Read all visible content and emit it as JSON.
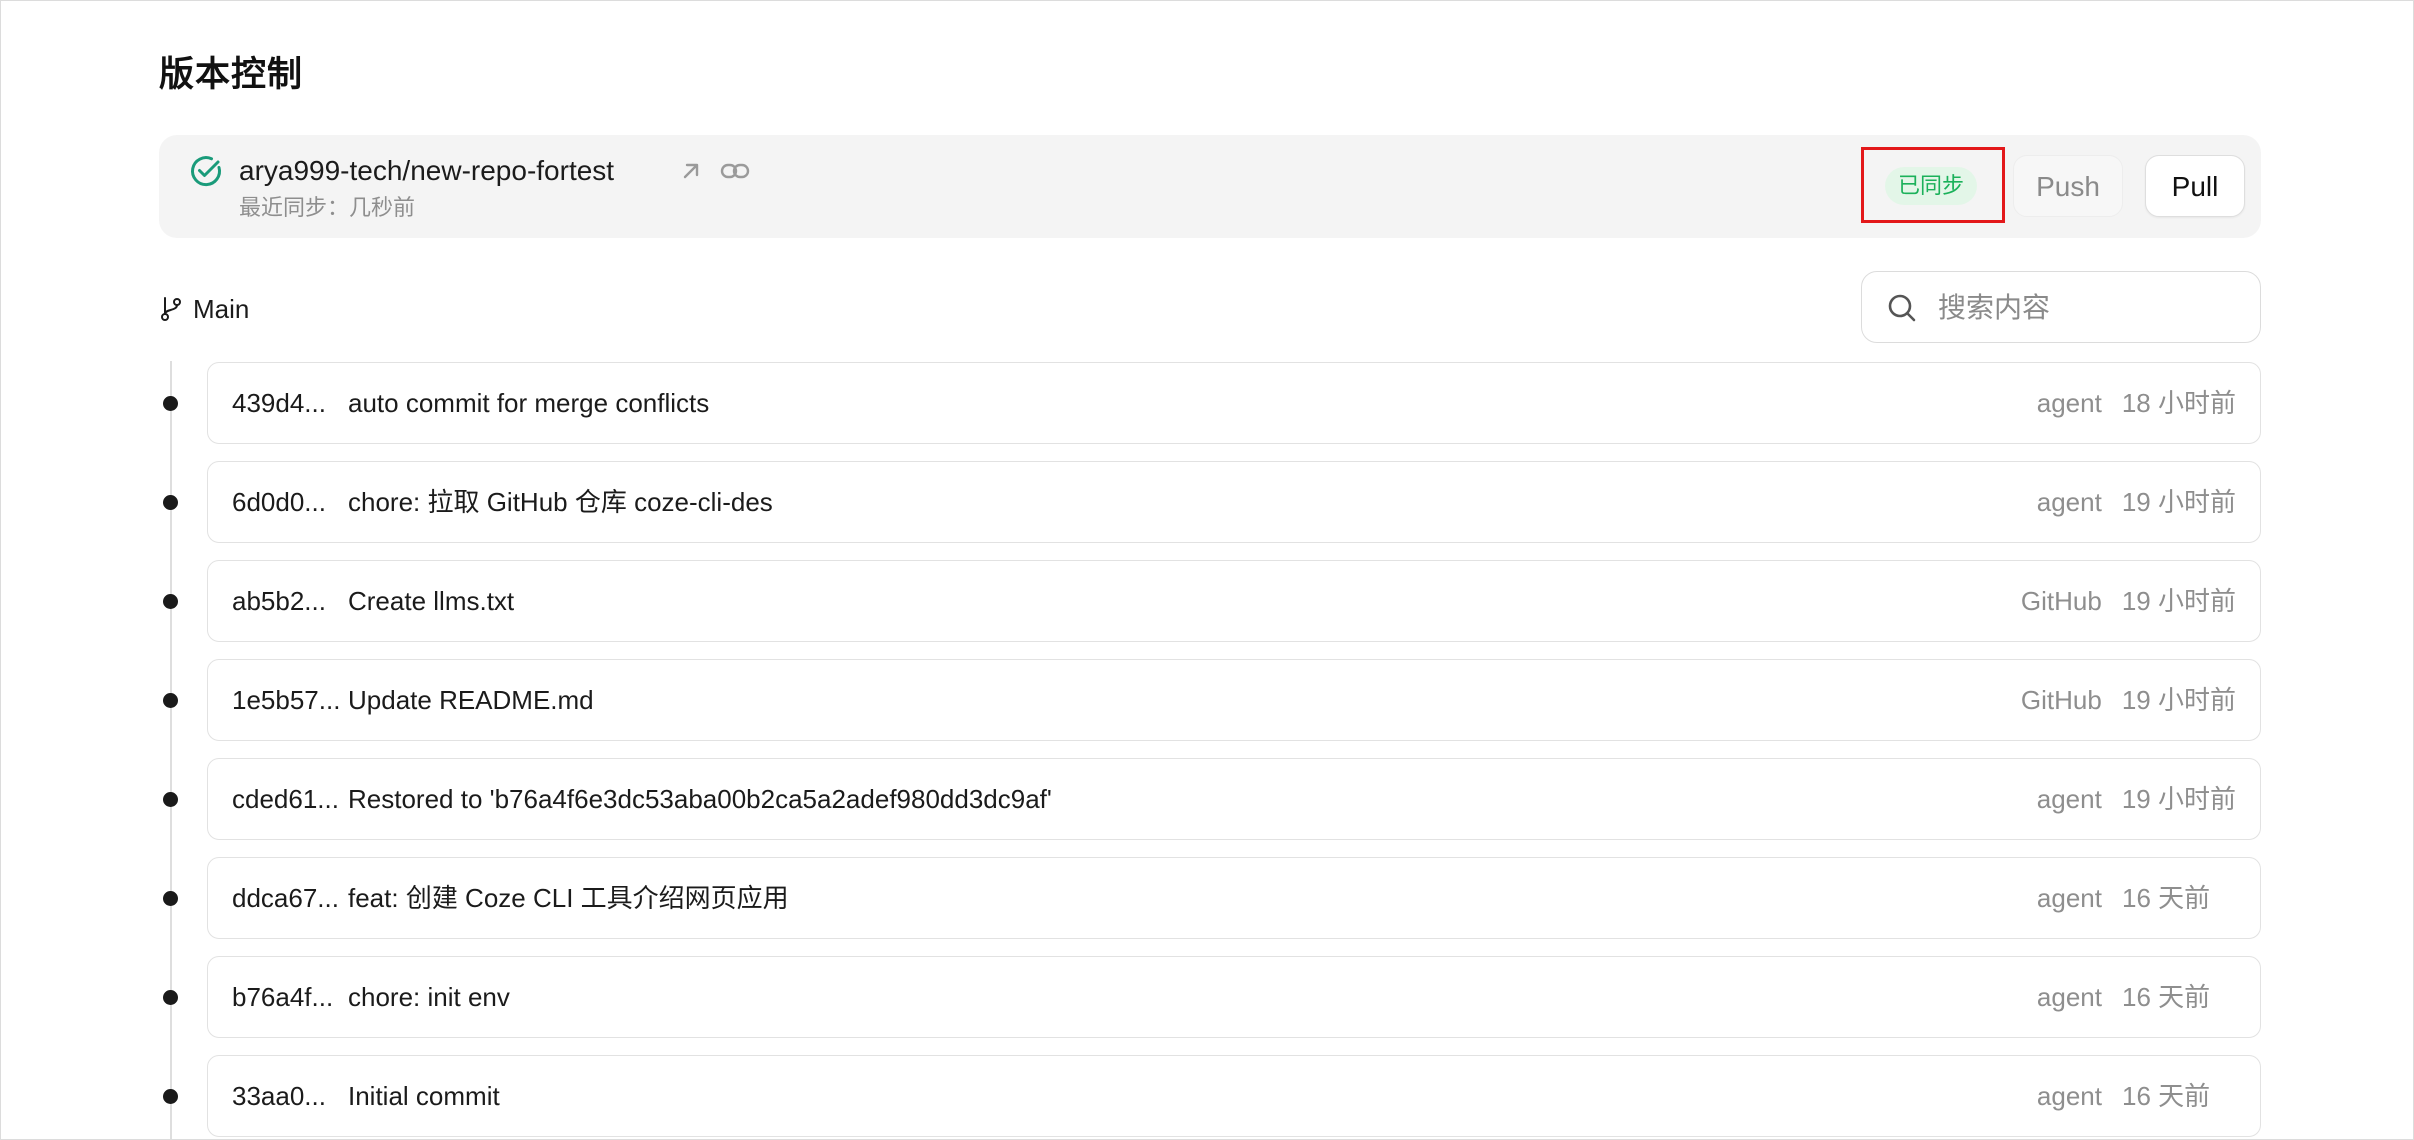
{
  "page": {
    "title": "版本控制"
  },
  "repo": {
    "name": "arya999-tech/new-repo-fortest",
    "last_sync": "最近同步：几秒前",
    "status": "已同步",
    "push_label": "Push",
    "pull_label": "Pull"
  },
  "branch": {
    "label": "Main"
  },
  "search": {
    "placeholder": "搜索内容",
    "value": ""
  },
  "commits": [
    {
      "hash": "439d4...",
      "message": "auto commit for merge conflicts",
      "author": "agent",
      "time": "18 小时前"
    },
    {
      "hash": "6d0d0...",
      "message": "chore: 拉取 GitHub 仓库 coze-cli-des",
      "author": "agent",
      "time": "19 小时前"
    },
    {
      "hash": "ab5b2...",
      "message": "Create llms.txt",
      "author": "GitHub",
      "time": "19 小时前"
    },
    {
      "hash": "1e5b57...",
      "message": "Update README.md",
      "author": "GitHub",
      "time": "19 小时前"
    },
    {
      "hash": "cded61...",
      "message": "Restored to 'b76a4f6e3dc53aba00b2ca5a2adef980dd3dc9af'",
      "author": "agent",
      "time": "19 小时前"
    },
    {
      "hash": "ddca67...",
      "message": "feat: 创建 Coze CLI 工具介绍网页应用",
      "author": "agent",
      "time": "16 天前"
    },
    {
      "hash": "b76a4f...",
      "message": "chore: init env",
      "author": "agent",
      "time": "16 天前"
    },
    {
      "hash": "33aa0...",
      "message": "Initial commit",
      "author": "agent",
      "time": "16 天前"
    }
  ],
  "colors": {
    "status_green": "#1bb15a",
    "status_bg": "#e3f6e8",
    "highlight_red": "#e3181a",
    "check_teal": "#1a9b7a"
  },
  "icons": {
    "repo_status": "check-circle-icon",
    "open_external": "arrow-up-right-icon",
    "copy_link": "link-icon",
    "branch": "git-branch-icon",
    "search": "search-icon"
  }
}
